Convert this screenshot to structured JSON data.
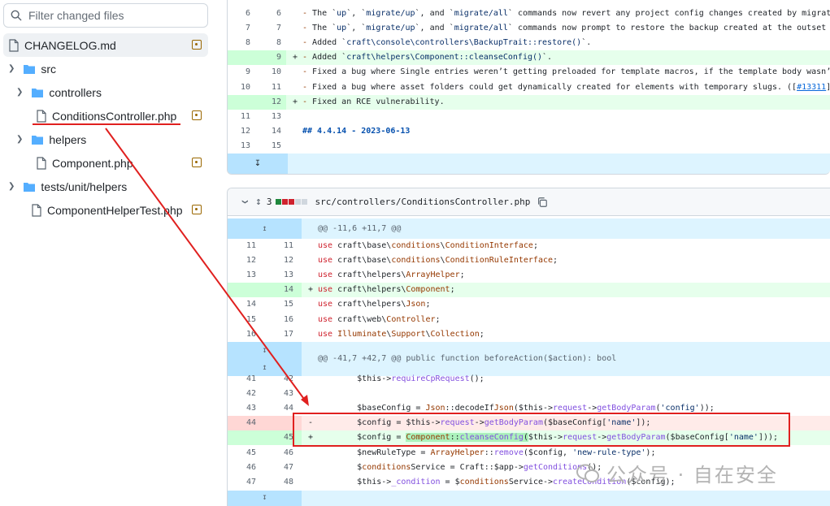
{
  "sidebar": {
    "search_placeholder": "Filter changed files",
    "items": [
      {
        "label": "CHANGELOG.md",
        "type": "file"
      },
      {
        "label": "src",
        "type": "folder"
      },
      {
        "label": "controllers",
        "type": "folder"
      },
      {
        "label": "ConditionsController.php",
        "type": "file"
      },
      {
        "label": "helpers",
        "type": "folder"
      },
      {
        "label": "Component.php",
        "type": "file"
      },
      {
        "label": "tests/unit/helpers",
        "type": "folder"
      },
      {
        "label": "ComponentHelperTest.php",
        "type": "file"
      }
    ]
  },
  "pane1": {
    "rows": [
      {
        "l": "6",
        "r": "6",
        "s": "",
        "t": "- The `up`, `migrate/up`, and `migrate/all` commands now revert any project config changes created by migrati"
      },
      {
        "l": "7",
        "r": "7",
        "s": "",
        "t": "- The `up`, `migrate/up`, and `migrate/all` commands now prompt to restore the backup created at the outset o"
      },
      {
        "l": "8",
        "r": "8",
        "s": "",
        "t": "- Added `craft\\console\\controllers\\BackupTrait::restore()`."
      },
      {
        "l": "",
        "r": "9",
        "s": "+",
        "t": "- Added `craft\\helpers\\Component::cleanseConfig()`."
      },
      {
        "l": "9",
        "r": "10",
        "s": "",
        "t": "- Fixed a bug where Single entries weren’t getting preloaded for template macros, if the template body wasn’t"
      },
      {
        "l": "10",
        "r": "11",
        "s": "",
        "t": "- Fixed a bug where asset folders could get dynamically created for elements with temporary slugs. ([#13311]"
      },
      {
        "l": "",
        "r": "12",
        "s": "+",
        "t": "- Fixed an RCE vulnerability."
      },
      {
        "l": "11",
        "r": "13",
        "s": "",
        "t": ""
      },
      {
        "l": "12",
        "r": "14",
        "s": "",
        "t": "## 4.4.14 - 2023-06-13"
      },
      {
        "l": "13",
        "r": "15",
        "s": "",
        "t": ""
      }
    ]
  },
  "pane2": {
    "changes": "3",
    "filename": "src/controllers/ConditionsController.php",
    "hunk1": "@@ -11,6 +11,7 @@",
    "hunk2": "@@ -41,7 +42,7 @@ public function beforeAction($action): bool",
    "rows_a": [
      {
        "l": "11",
        "r": "11",
        "s": "",
        "t": "use craft\\base\\conditions\\ConditionInterface;"
      },
      {
        "l": "12",
        "r": "12",
        "s": "",
        "t": "use craft\\base\\conditions\\ConditionRuleInterface;"
      },
      {
        "l": "13",
        "r": "13",
        "s": "",
        "t": "use craft\\helpers\\ArrayHelper;"
      },
      {
        "l": "",
        "r": "14",
        "s": "+",
        "t": "use craft\\helpers\\Component;"
      },
      {
        "l": "14",
        "r": "15",
        "s": "",
        "t": "use craft\\helpers\\Json;"
      },
      {
        "l": "15",
        "r": "16",
        "s": "",
        "t": "use craft\\web\\Controller;"
      },
      {
        "l": "16",
        "r": "17",
        "s": "",
        "t": "use Illuminate\\Support\\Collection;"
      }
    ],
    "rows_b": [
      {
        "l": "41",
        "r": "42",
        "s": "",
        "t": "        $this->requireCpRequest();"
      },
      {
        "l": "42",
        "r": "43",
        "s": "",
        "t": ""
      },
      {
        "l": "43",
        "r": "44",
        "s": "",
        "t": "        $baseConfig = Json::decodeIfJson($this->request->getBodyParam('config'));"
      },
      {
        "l": "44",
        "r": "",
        "s": "-",
        "t": "        $config = $this->request->getBodyParam($baseConfig['name']);"
      },
      {
        "l": "",
        "r": "45",
        "s": "+",
        "t": "        $config = Component::cleanseConfig($this->request->getBodyParam($baseConfig['name']));"
      },
      {
        "l": "45",
        "r": "46",
        "s": "",
        "t": "        $newRuleType = ArrayHelper::remove($config, 'new-rule-type');"
      },
      {
        "l": "46",
        "r": "47",
        "s": "",
        "t": "        $conditionsService = Craft::$app->getConditions();"
      },
      {
        "l": "47",
        "r": "48",
        "s": "",
        "t": "        $this->_condition = $conditionsService->createCondition($config);"
      }
    ]
  },
  "watermark": "公众号 · 自在安全",
  "colors": {
    "annotation": "#e0201f",
    "add_bg": "#e6ffec",
    "del_bg": "#ffebe9",
    "hunk_bg": "#ddf4ff"
  }
}
